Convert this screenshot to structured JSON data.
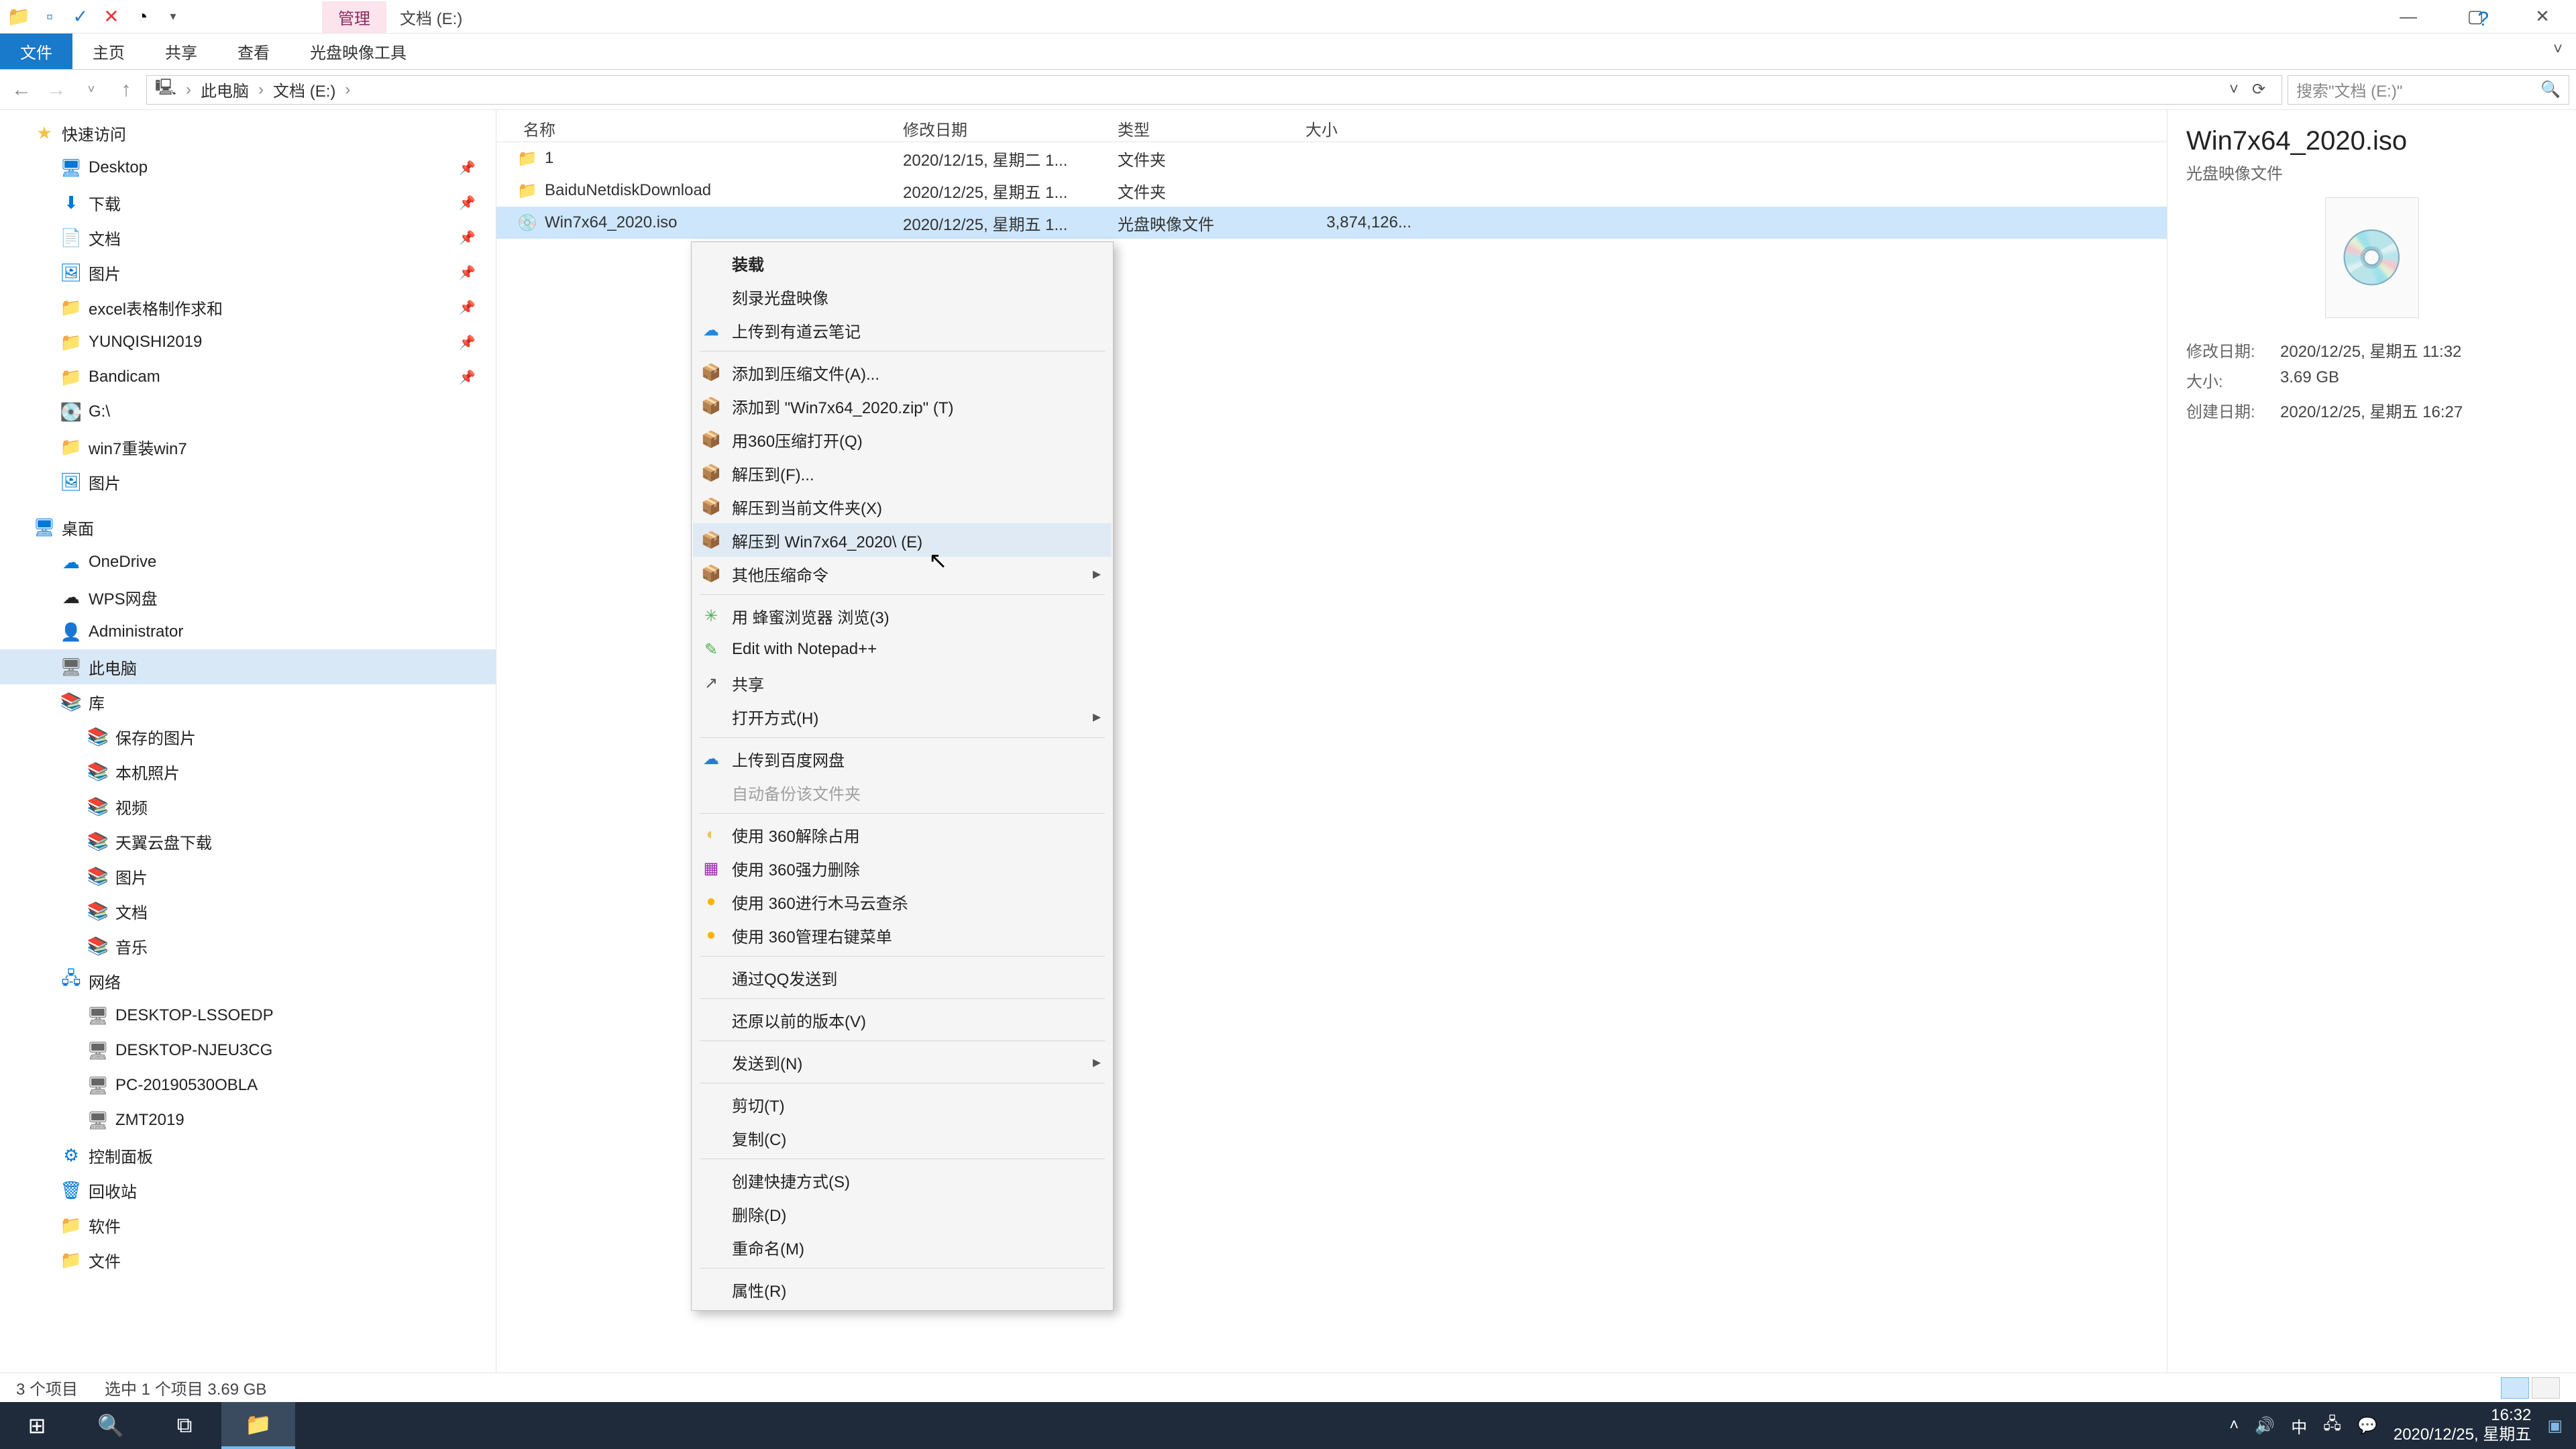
{
  "window": {
    "manage_tab": "管理",
    "title": "文档 (E:)",
    "ribbon": [
      "文件",
      "主页",
      "共享",
      "查看",
      "光盘映像工具"
    ]
  },
  "breadcrumb": [
    "此电脑",
    "文档 (E:)"
  ],
  "search_placeholder": "搜索\"文档 (E:)\"",
  "tree": {
    "quick": "快速访问",
    "quick_items": [
      "Desktop",
      "下载",
      "文档",
      "图片",
      "excel表格制作求和",
      "YUNQISHI2019",
      "Bandicam",
      "G:\\",
      "win7重装win7",
      "图片"
    ],
    "desktop": "桌面",
    "desktop_items": [
      "OneDrive",
      "WPS网盘",
      "Administrator",
      "此电脑",
      "库"
    ],
    "lib_items": [
      "保存的图片",
      "本机照片",
      "视频",
      "天翼云盘下载",
      "图片",
      "文档",
      "音乐"
    ],
    "network": "网络",
    "net_items": [
      "DESKTOP-LSSOEDP",
      "DESKTOP-NJEU3CG",
      "PC-20190530OBLA",
      "ZMT2019"
    ],
    "extra": [
      "控制面板",
      "回收站",
      "软件",
      "文件"
    ]
  },
  "columns": {
    "name": "名称",
    "date": "修改日期",
    "type": "类型",
    "size": "大小"
  },
  "rows": [
    {
      "name": "1",
      "date": "2020/12/15, 星期二 1...",
      "type": "文件夹",
      "size": "",
      "icon": "folder"
    },
    {
      "name": "BaiduNetdiskDownload",
      "date": "2020/12/25, 星期五 1...",
      "type": "文件夹",
      "size": "",
      "icon": "folder"
    },
    {
      "name": "Win7x64_2020.iso",
      "date": "2020/12/25, 星期五 1...",
      "type": "光盘映像文件",
      "size": "3,874,126...",
      "icon": "iso",
      "selected": true
    }
  ],
  "ctx": [
    {
      "label": "装载",
      "bold": true
    },
    {
      "label": "刻录光盘映像"
    },
    {
      "label": "上传到有道云笔记",
      "icon": "☁",
      "color": "#1e88e5"
    },
    {
      "sep": true
    },
    {
      "label": "添加到压缩文件(A)...",
      "icon": "📦",
      "color": "#f0c24b"
    },
    {
      "label": "添加到 \"Win7x64_2020.zip\" (T)",
      "icon": "📦",
      "color": "#f0c24b"
    },
    {
      "label": "用360压缩打开(Q)",
      "icon": "📦",
      "color": "#f0c24b"
    },
    {
      "label": "解压到(F)...",
      "icon": "📦",
      "color": "#f0c24b"
    },
    {
      "label": "解压到当前文件夹(X)",
      "icon": "📦",
      "color": "#f0c24b"
    },
    {
      "label": "解压到 Win7x64_2020\\ (E)",
      "icon": "📦",
      "color": "#f0c24b",
      "hover": true
    },
    {
      "label": "其他压缩命令",
      "icon": "📦",
      "color": "#f0c24b",
      "arrow": true
    },
    {
      "sep": true
    },
    {
      "label": "用 蜂蜜浏览器 浏览(3)",
      "icon": "✳",
      "color": "#4caf50"
    },
    {
      "label": "Edit with Notepad++",
      "icon": "✎",
      "color": "#4caf50"
    },
    {
      "label": "共享",
      "icon": "↗",
      "color": "#555"
    },
    {
      "label": "打开方式(H)",
      "arrow": true
    },
    {
      "sep": true
    },
    {
      "label": "上传到百度网盘",
      "icon": "☁",
      "color": "#2a7bd1"
    },
    {
      "label": "自动备份该文件夹",
      "disabled": true
    },
    {
      "sep": true
    },
    {
      "label": "使用 360解除占用",
      "icon": "◐",
      "color": "#f0c24b"
    },
    {
      "label": "使用 360强力删除",
      "icon": "▦",
      "color": "#9c27b0"
    },
    {
      "label": "使用 360进行木马云查杀",
      "icon": "●",
      "color": "#ffb300"
    },
    {
      "label": "使用 360管理右键菜单",
      "icon": "●",
      "color": "#ffb300"
    },
    {
      "sep": true
    },
    {
      "label": "通过QQ发送到"
    },
    {
      "sep": true
    },
    {
      "label": "还原以前的版本(V)"
    },
    {
      "sep": true
    },
    {
      "label": "发送到(N)",
      "arrow": true
    },
    {
      "sep": true
    },
    {
      "label": "剪切(T)"
    },
    {
      "label": "复制(C)"
    },
    {
      "sep": true
    },
    {
      "label": "创建快捷方式(S)"
    },
    {
      "label": "删除(D)"
    },
    {
      "label": "重命名(M)"
    },
    {
      "sep": true
    },
    {
      "label": "属性(R)"
    }
  ],
  "details": {
    "title": "Win7x64_2020.iso",
    "type": "光盘映像文件",
    "meta": {
      "mod_k": "修改日期:",
      "mod_v": "2020/12/25, 星期五 11:32",
      "size_k": "大小:",
      "size_v": "3.69 GB",
      "create_k": "创建日期:",
      "create_v": "2020/12/25, 星期五 16:27"
    }
  },
  "status": {
    "s1": "3 个项目",
    "s2": "选中 1 个项目  3.69 GB"
  },
  "taskbar": {
    "time": "16:32",
    "date": "2020/12/25, 星期五",
    "ime": "中"
  }
}
